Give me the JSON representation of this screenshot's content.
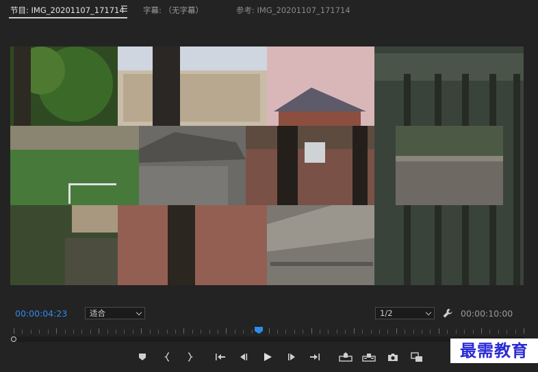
{
  "tabs": {
    "program": "节目: IMG_20201107_171714",
    "menu_icon": "hamburger-icon",
    "caption": "字幕: （无字幕）",
    "reference": "参考: IMG_20201107_171714"
  },
  "playback": {
    "current_time": "00:00:04:23",
    "fit_label": "适合",
    "resolution": "1/2",
    "duration": "00:00:10:00"
  },
  "timeline": {
    "playhead_fraction": 0.48
  },
  "controls": [
    {
      "name": "add-marker-button",
      "icon": "marker-icon"
    },
    {
      "name": "mark-in-button",
      "icon": "mark-in-icon"
    },
    {
      "name": "mark-out-button",
      "icon": "mark-out-icon"
    },
    {
      "name": "go-to-in-button",
      "icon": "go-to-in-icon"
    },
    {
      "name": "step-back-button",
      "icon": "step-back-icon"
    },
    {
      "name": "play-button",
      "icon": "play-icon"
    },
    {
      "name": "step-forward-button",
      "icon": "step-forward-icon"
    },
    {
      "name": "go-to-out-button",
      "icon": "go-to-out-icon"
    },
    {
      "name": "lift-button",
      "icon": "lift-icon"
    },
    {
      "name": "extract-button",
      "icon": "extract-icon"
    },
    {
      "name": "export-frame-button",
      "icon": "camera-icon"
    },
    {
      "name": "compare-view-button",
      "icon": "compare-icon"
    }
  ],
  "watermark": "最需教育",
  "colors": {
    "background": "#232323",
    "accent_timecode": "#2d8ceb",
    "playhead": "#2d8ceb",
    "watermark_text": "#2a2ad6"
  }
}
